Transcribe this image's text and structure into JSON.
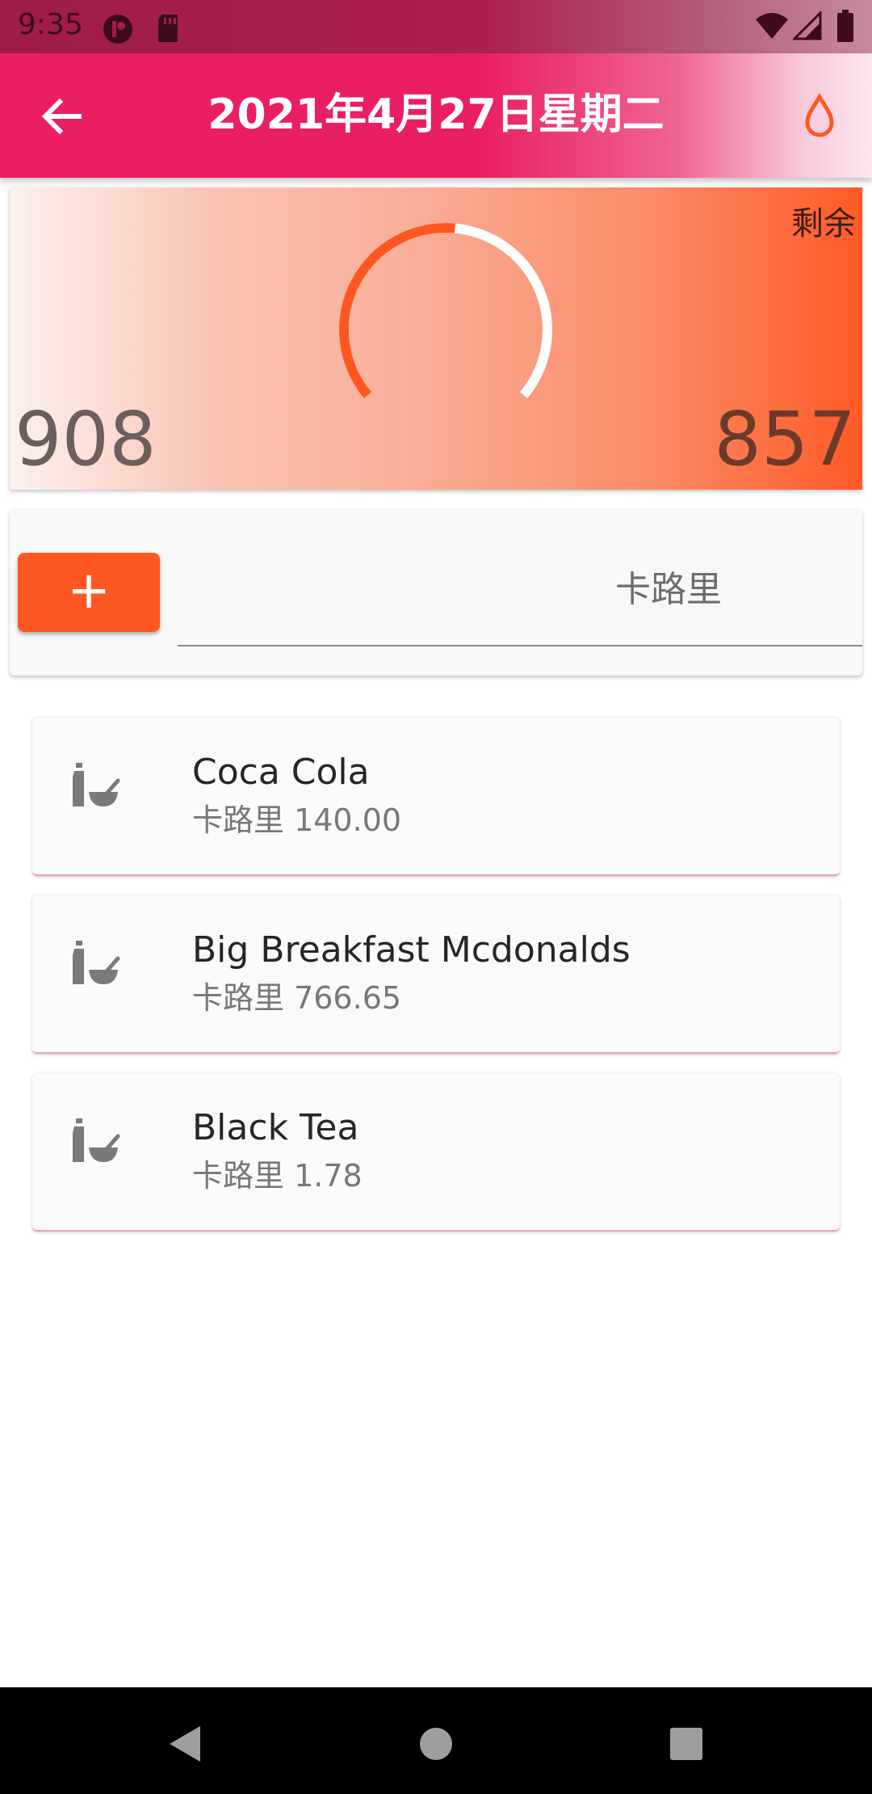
{
  "status_bar": {
    "time": "9:35"
  },
  "app_bar": {
    "title": "2021年4月27日星期二"
  },
  "summary": {
    "remaining_label": "剩余",
    "left_value": "908",
    "right_value": "857",
    "gauge_progress": 0.52,
    "colors": {
      "accent": "#ff5722",
      "track": "#ffffff"
    }
  },
  "add_form": {
    "add_symbol": "+",
    "food_value": "",
    "calorie_placeholder": "卡路里"
  },
  "food_items": [
    {
      "name": "Coca Cola",
      "calories": "卡路里 140.00",
      "icon": "food-bottle-bowl-icon"
    },
    {
      "name": "Big Breakfast Mcdonalds",
      "calories": "卡路里 766.65",
      "icon": "food-bottle-bowl-icon"
    },
    {
      "name": "Black Tea",
      "calories": "卡路里 1.78",
      "icon": "food-bottle-bowl-icon"
    }
  ],
  "theme": {
    "primary": "#e91e63",
    "accent": "#ff5722"
  }
}
